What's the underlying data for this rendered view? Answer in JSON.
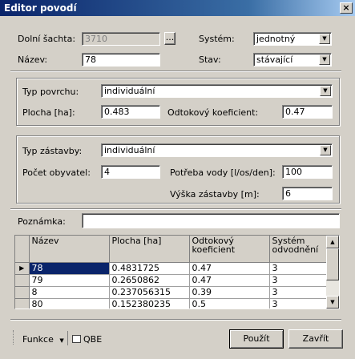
{
  "window": {
    "title": "Editor povodí",
    "close": "×"
  },
  "top": {
    "dolni_sachta_label": "Dolní šachta:",
    "dolni_sachta_value": "3710",
    "browse_label": "...",
    "nazev_label": "Název:",
    "nazev_value": "78",
    "system_label": "Systém:",
    "system_value": "jednotný",
    "stav_label": "Stav:",
    "stav_value": "stávající"
  },
  "povrch": {
    "typ_label": "Typ povrchu:",
    "typ_value": "individuální",
    "plocha_label": "Plocha [ha]:",
    "plocha_value": "0.483",
    "odtok_label": "Odtokový koeficient:",
    "odtok_value": "0.47"
  },
  "zastavba": {
    "typ_label": "Typ zástavby:",
    "typ_value": "individuální",
    "obyvatel_label": "Počet obyvatel:",
    "obyvatel_value": "4",
    "voda_label": "Potřeba vody [l/os/den]:",
    "voda_value": "100",
    "vyska_label": "Výška zástavby [m]:",
    "vyska_value": "6"
  },
  "poznamka": {
    "label": "Poznámka:",
    "value": ""
  },
  "grid": {
    "headers": [
      "Název",
      "Plocha [ha]",
      "Odtokový koeficient",
      "Systém odvodnění"
    ],
    "rows": [
      [
        "78",
        "0.4831725",
        "0.47",
        "3"
      ],
      [
        "79",
        "0.2650862",
        "0.47",
        "3"
      ],
      [
        "8",
        "0.237056315",
        "0.39",
        "3"
      ],
      [
        "80",
        "0.152380235",
        "0.5",
        "3"
      ]
    ],
    "selected_row": 0,
    "row_marker": "▶"
  },
  "footer": {
    "funkce_label": "Funkce",
    "qbe_label": "QBE",
    "pouzit_label": "Použít",
    "zavrit_label": "Zavřít"
  }
}
